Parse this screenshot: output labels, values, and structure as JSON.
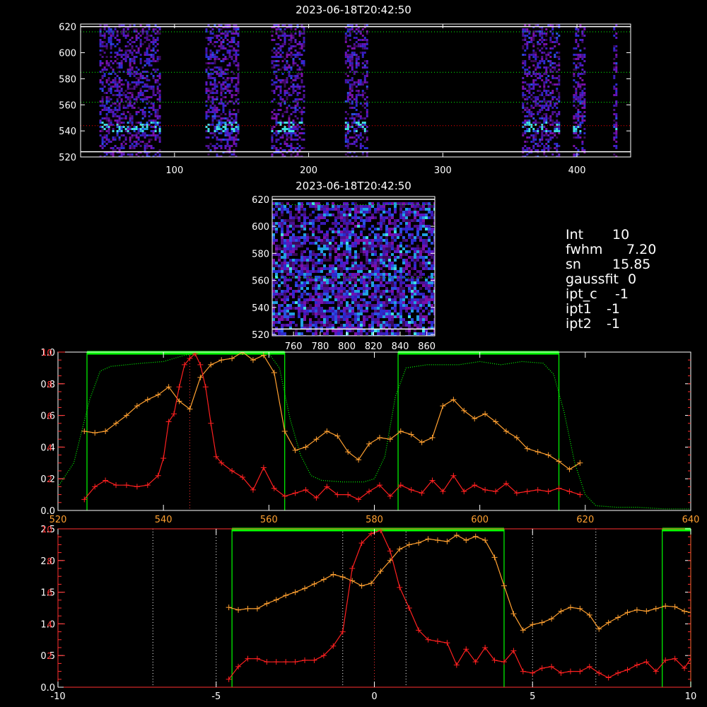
{
  "panels": {
    "top_image": {
      "title": "2023-06-18T20:42:50",
      "xticks": [
        "100",
        "200",
        "300",
        "400"
      ],
      "yticks": [
        "520",
        "540",
        "560",
        "580",
        "600",
        "620"
      ]
    },
    "middle_image": {
      "title": "2023-06-18T20:42:50",
      "xticks": [
        "760",
        "780",
        "800",
        "820",
        "840",
        "860"
      ],
      "yticks": [
        "520",
        "540",
        "560",
        "580",
        "600",
        "620"
      ]
    }
  },
  "info": {
    "rows": [
      {
        "key": "Int",
        "value": "10"
      },
      {
        "key": "fwhm",
        "value": "7.20"
      },
      {
        "key": "sn",
        "value": "15.85"
      },
      {
        "key": "gaussfit",
        "value": "0"
      },
      {
        "key": "ipt_c",
        "value": "-1"
      },
      {
        "key": "ipt1",
        "value": "-1"
      },
      {
        "key": "ipt2",
        "value": "-1"
      }
    ]
  },
  "chart_data": [
    {
      "type": "heatmap",
      "title": "2023-06-18T20:42:50",
      "xlim": [
        30,
        440
      ],
      "ylim": [
        520,
        622
      ],
      "xticks": [
        100,
        200,
        300,
        400
      ],
      "yticks": [
        520,
        540,
        560,
        580,
        600,
        620
      ],
      "bright_column_bands": [
        [
          44,
          89
        ],
        [
          123,
          147
        ],
        [
          172,
          196
        ],
        [
          227,
          244
        ],
        [
          359,
          386
        ],
        [
          397,
          405
        ],
        [
          427,
          429
        ]
      ],
      "horizontal_lines": [
        {
          "y": 524,
          "color": "#ffffff",
          "style": "solid"
        },
        {
          "y": 544,
          "color": "#ff0000",
          "style": "dotted"
        },
        {
          "y": 562,
          "color": "#00ff00",
          "style": "dotted"
        },
        {
          "y": 585,
          "color": "#00ff00",
          "style": "dotted"
        },
        {
          "y": 616,
          "color": "#00ff00",
          "style": "dotted"
        },
        {
          "y": 620,
          "color": "#ffffff",
          "style": "solid"
        }
      ]
    },
    {
      "type": "heatmap",
      "title": "2023-06-18T20:42:50",
      "xlim": [
        744,
        866
      ],
      "ylim": [
        519,
        622
      ],
      "xticks": [
        760,
        780,
        800,
        820,
        840,
        860
      ],
      "yticks": [
        520,
        540,
        560,
        580,
        600,
        620
      ],
      "horizontal_lines": [
        {
          "y": 524,
          "color": "#ffffff",
          "style": "solid"
        },
        {
          "y": 562,
          "color": "#00ff00",
          "style": "dotted"
        },
        {
          "y": 616,
          "color": "#00ff00",
          "style": "dotted"
        },
        {
          "y": 620,
          "color": "#ffffff",
          "style": "solid"
        }
      ]
    },
    {
      "type": "line",
      "xlim": [
        520,
        640
      ],
      "xticks": [
        520,
        540,
        560,
        580,
        600,
        620,
        640
      ],
      "left_axis": {
        "ylim": [
          0.0,
          1.0
        ],
        "ticks": [
          "0.0",
          "0.2",
          "0.4",
          "0.6",
          "0.8",
          "1.0"
        ],
        "color": "#ffffff"
      },
      "red_axis": {
        "ylim": [
          0,
          10
        ],
        "ticks": [
          "2",
          "4",
          "6",
          "8",
          "10"
        ],
        "color": "#ff3030"
      },
      "green_windows": [
        [
          525.5,
          563
        ],
        [
          584.5,
          615
        ]
      ],
      "vertical_markers": [
        {
          "x": 545,
          "color": "#ff3030"
        }
      ],
      "series": [
        {
          "color": "#00ff00",
          "style": "dotted",
          "marker": "none",
          "axis": "left",
          "x": [
            520,
            523,
            526,
            528,
            530,
            533,
            536,
            540,
            544,
            548,
            552,
            556,
            560,
            562,
            564,
            566,
            568,
            570,
            574,
            578,
            580,
            582,
            584,
            586,
            590,
            596,
            600,
            604,
            608,
            612,
            614,
            616,
            618,
            620,
            622,
            626,
            630,
            635,
            640
          ],
          "y": [
            0.15,
            0.3,
            0.7,
            0.88,
            0.91,
            0.92,
            0.93,
            0.94,
            0.98,
            1.0,
            1.0,
            1.0,
            0.99,
            0.9,
            0.58,
            0.35,
            0.22,
            0.19,
            0.18,
            0.18,
            0.2,
            0.34,
            0.72,
            0.9,
            0.92,
            0.92,
            0.94,
            0.92,
            0.94,
            0.93,
            0.86,
            0.62,
            0.3,
            0.1,
            0.03,
            0.02,
            0.02,
            0.01,
            0.01
          ]
        },
        {
          "color": "#ffa030",
          "style": "solid",
          "marker": "+",
          "axis": "left",
          "x": [
            525,
            527,
            529,
            531,
            533,
            535,
            537,
            539,
            541,
            543,
            545,
            547,
            549,
            551,
            553,
            555,
            557,
            559,
            561,
            563,
            565,
            567,
            569,
            571,
            573,
            575,
            577,
            579,
            581,
            583,
            585,
            587,
            589,
            591,
            593,
            595,
            597,
            599,
            601,
            603,
            605,
            607,
            609,
            611,
            613,
            615,
            617,
            619
          ],
          "y": [
            0.5,
            0.49,
            0.5,
            0.55,
            0.6,
            0.66,
            0.7,
            0.73,
            0.78,
            0.69,
            0.64,
            0.84,
            0.92,
            0.95,
            0.96,
            1.0,
            0.95,
            0.98,
            0.87,
            0.5,
            0.38,
            0.4,
            0.45,
            0.5,
            0.47,
            0.37,
            0.32,
            0.42,
            0.46,
            0.45,
            0.5,
            0.48,
            0.43,
            0.46,
            0.66,
            0.7,
            0.63,
            0.58,
            0.61,
            0.56,
            0.5,
            0.46,
            0.39,
            0.37,
            0.35,
            0.31,
            0.26,
            0.3
          ]
        },
        {
          "color": "#ff2020",
          "style": "solid",
          "marker": "+",
          "axis": "red",
          "x": [
            525,
            527,
            529,
            531,
            533,
            535,
            537,
            539,
            540,
            541,
            542,
            543,
            544,
            545,
            546,
            547,
            548,
            549,
            550,
            551,
            553,
            555,
            557,
            559,
            561,
            563,
            565,
            567,
            569,
            571,
            573,
            575,
            577,
            579,
            581,
            583,
            585,
            587,
            589,
            591,
            593,
            595,
            597,
            599,
            601,
            603,
            605,
            607,
            609,
            611,
            613,
            615,
            617,
            619
          ],
          "y": [
            0.7,
            1.5,
            1.9,
            1.6,
            1.6,
            1.5,
            1.6,
            2.2,
            3.3,
            5.6,
            6.1,
            7.8,
            9.2,
            9.6,
            9.9,
            9.2,
            7.8,
            5.5,
            3.4,
            3.0,
            2.5,
            2.1,
            1.3,
            2.7,
            1.4,
            0.9,
            1.1,
            1.3,
            0.8,
            1.5,
            1.0,
            1.0,
            0.7,
            1.2,
            1.6,
            0.9,
            1.6,
            1.3,
            1.1,
            1.9,
            1.2,
            2.2,
            1.2,
            1.6,
            1.3,
            1.2,
            1.7,
            1.1,
            1.2,
            1.3,
            1.2,
            1.4,
            1.2,
            1.0
          ]
        }
      ]
    },
    {
      "type": "line",
      "xlim": [
        -10,
        10
      ],
      "xticks": [
        -10,
        -5,
        0,
        5,
        10
      ],
      "left_axis": {
        "ylim": [
          0.0,
          2.5
        ],
        "ticks": [
          "0.0",
          "0.5",
          "1.0",
          "1.5",
          "2.0",
          "2.5"
        ],
        "color": "#ffffff"
      },
      "red_axis": {
        "ylim": [
          0,
          10
        ],
        "ticks": [
          "2",
          "4",
          "6",
          "8",
          "10"
        ],
        "color": "#ff3030"
      },
      "green_windows": [
        [
          -4.5,
          4.1
        ],
        [
          9.1,
          10
        ]
      ],
      "vertical_markers": [
        {
          "x": -7,
          "color": "#ffffff"
        },
        {
          "x": -5,
          "color": "#ffffff"
        },
        {
          "x": -1,
          "color": "#ffffff"
        },
        {
          "x": 0,
          "color": "#ff3030"
        },
        {
          "x": 1,
          "color": "#ffffff"
        },
        {
          "x": 5,
          "color": "#ffffff"
        },
        {
          "x": 7,
          "color": "#ffffff"
        }
      ],
      "series": [
        {
          "color": "#ffa030",
          "style": "solid",
          "marker": "+",
          "axis": "left",
          "x": [
            -4.6,
            -4.3,
            -4.0,
            -3.7,
            -3.4,
            -3.1,
            -2.8,
            -2.5,
            -2.2,
            -1.9,
            -1.6,
            -1.3,
            -1.0,
            -0.7,
            -0.4,
            -0.1,
            0.2,
            0.5,
            0.8,
            1.1,
            1.4,
            1.7,
            2.0,
            2.3,
            2.6,
            2.9,
            3.2,
            3.5,
            3.8,
            4.1,
            4.4,
            4.7,
            5.0,
            5.3,
            5.6,
            5.9,
            6.2,
            6.5,
            6.8,
            7.1,
            7.4,
            7.7,
            8.0,
            8.3,
            8.6,
            8.9,
            9.2,
            9.5,
            9.8,
            10.0
          ],
          "y": [
            1.26,
            1.22,
            1.24,
            1.24,
            1.32,
            1.38,
            1.45,
            1.5,
            1.56,
            1.63,
            1.7,
            1.78,
            1.74,
            1.68,
            1.6,
            1.64,
            1.83,
            2.0,
            2.18,
            2.25,
            2.28,
            2.34,
            2.32,
            2.3,
            2.4,
            2.32,
            2.38,
            2.32,
            2.05,
            1.6,
            1.16,
            0.9,
            0.99,
            1.02,
            1.08,
            1.2,
            1.26,
            1.24,
            1.14,
            0.92,
            1.02,
            1.1,
            1.18,
            1.22,
            1.2,
            1.24,
            1.28,
            1.27,
            1.2,
            1.18
          ]
        },
        {
          "color": "#ff2020",
          "style": "solid",
          "marker": "+",
          "axis": "red",
          "x": [
            -4.6,
            -4.3,
            -4.0,
            -3.7,
            -3.4,
            -3.1,
            -2.8,
            -2.5,
            -2.2,
            -1.9,
            -1.6,
            -1.3,
            -1.0,
            -0.7,
            -0.4,
            -0.1,
            0.2,
            0.5,
            0.8,
            1.1,
            1.4,
            1.7,
            2.0,
            2.3,
            2.6,
            2.9,
            3.2,
            3.5,
            3.8,
            4.1,
            4.4,
            4.7,
            5.0,
            5.3,
            5.6,
            5.9,
            6.2,
            6.5,
            6.8,
            7.1,
            7.4,
            7.7,
            8.0,
            8.3,
            8.6,
            8.9,
            9.2,
            9.5,
            9.8,
            10.0
          ],
          "y": [
            0.5,
            1.3,
            1.8,
            1.8,
            1.6,
            1.6,
            1.6,
            1.6,
            1.7,
            1.7,
            2.0,
            2.6,
            3.5,
            7.5,
            9.1,
            9.7,
            9.9,
            8.6,
            6.3,
            5.0,
            3.6,
            3.0,
            2.9,
            2.8,
            1.4,
            2.4,
            1.6,
            2.5,
            1.7,
            1.6,
            2.3,
            1.0,
            0.9,
            1.2,
            1.3,
            0.9,
            1.0,
            1.0,
            1.3,
            0.9,
            0.6,
            0.9,
            1.1,
            1.4,
            1.6,
            1.0,
            1.7,
            1.8,
            1.2,
            1.8
          ]
        }
      ]
    }
  ]
}
